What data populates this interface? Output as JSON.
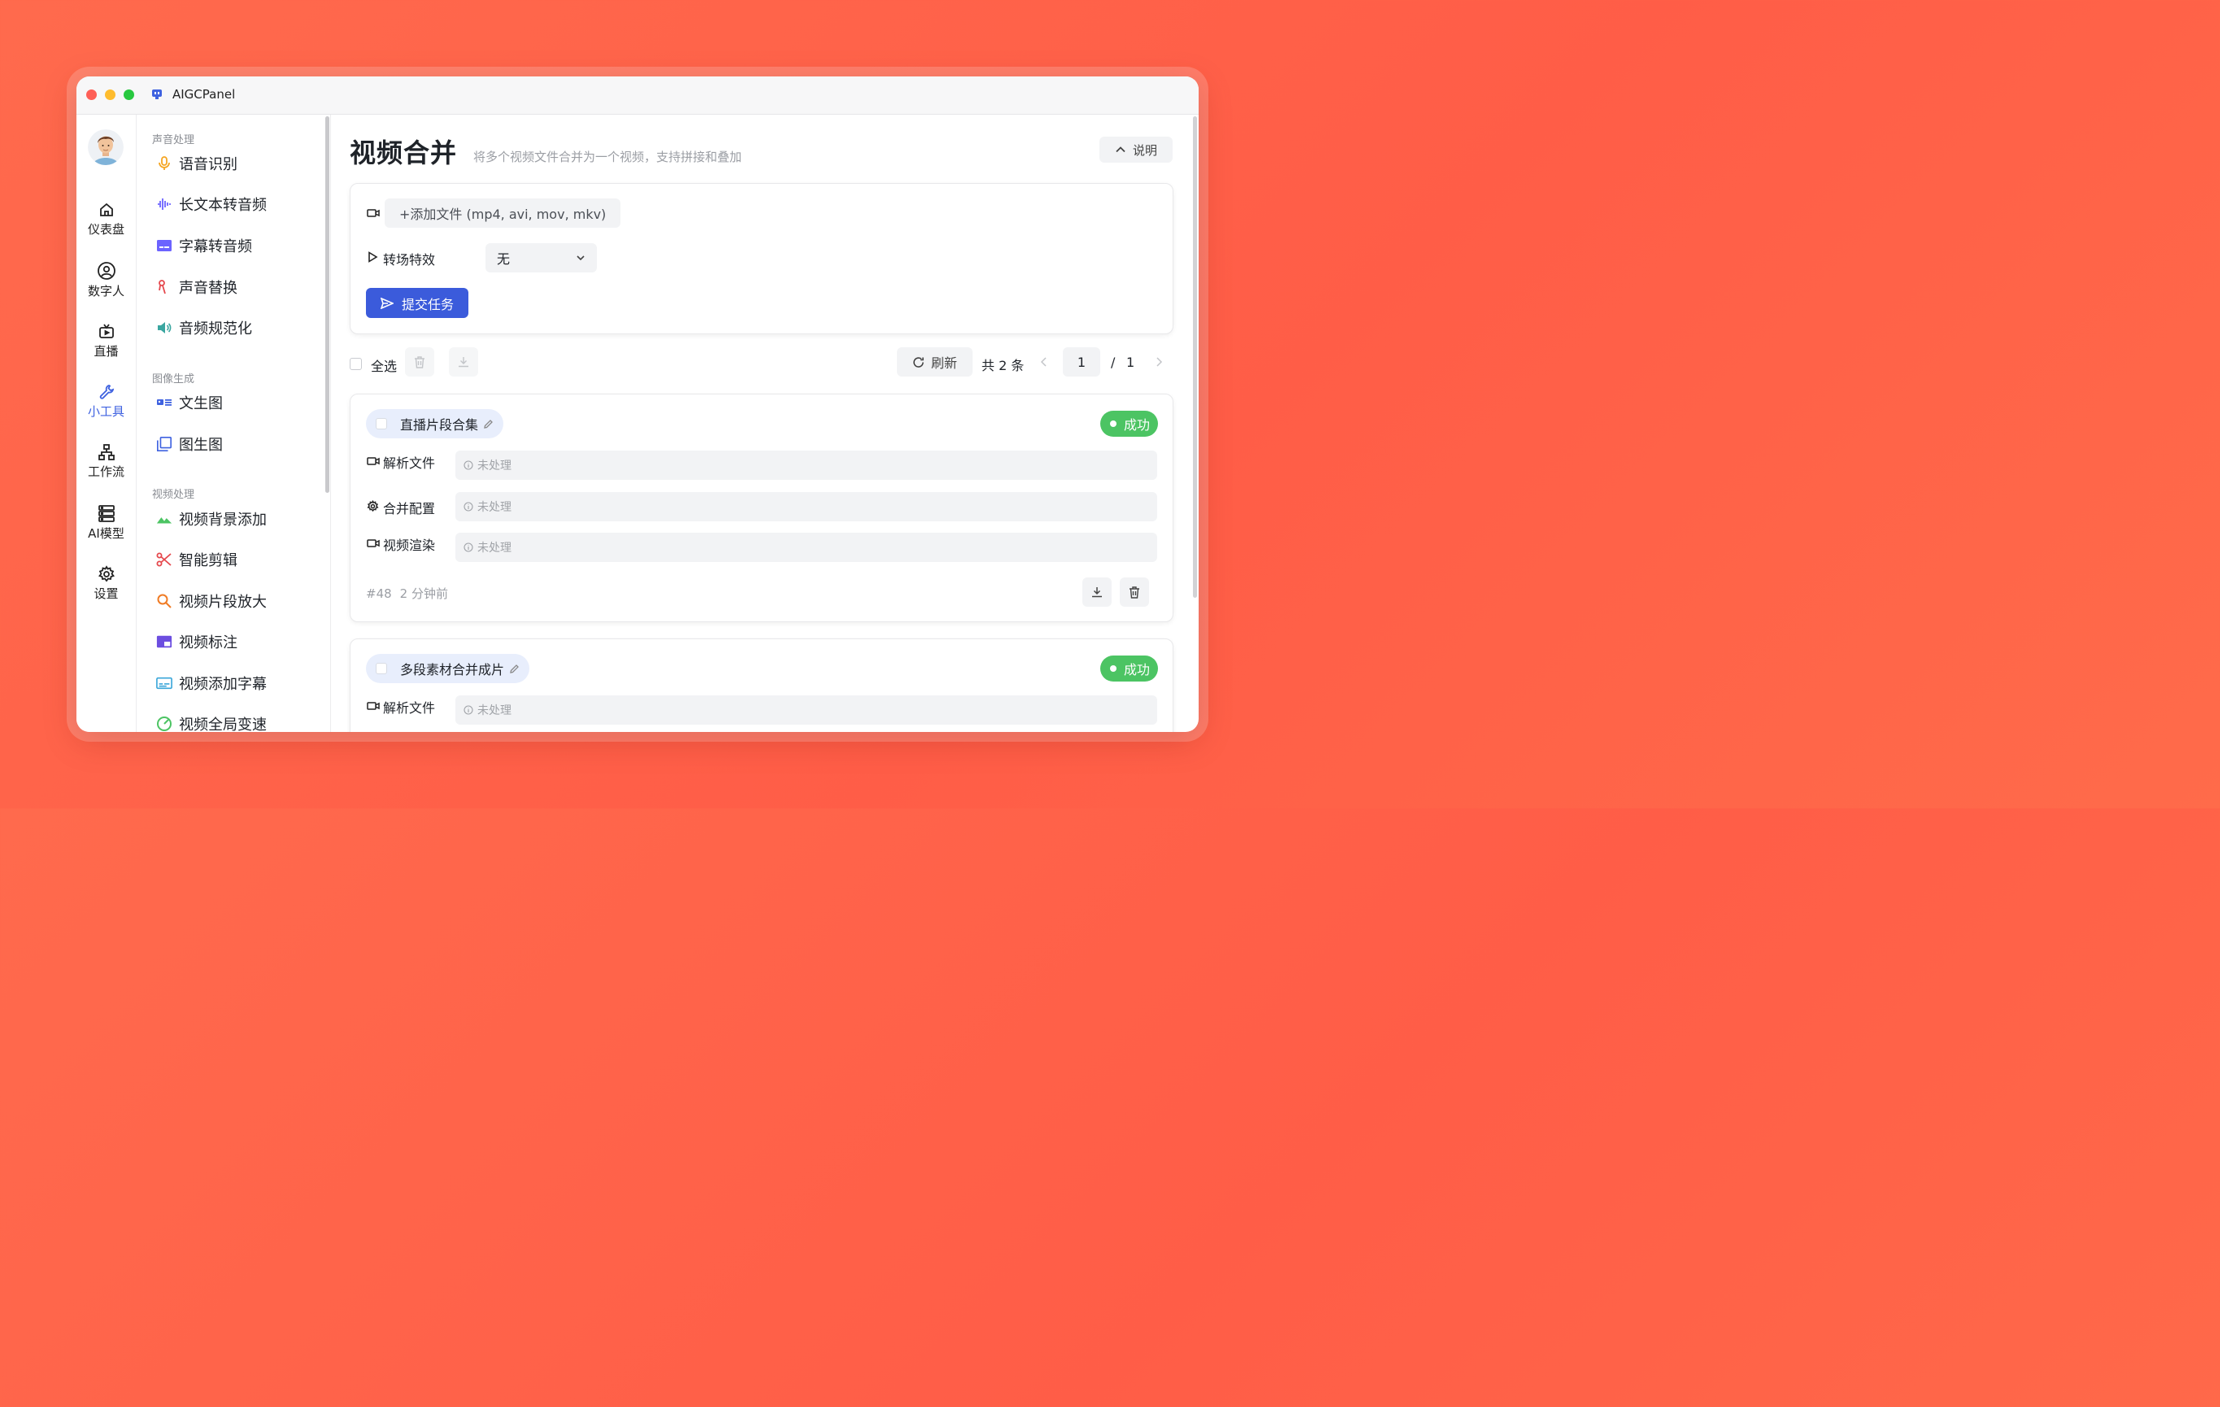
{
  "window": {
    "title": "AIGCPanel"
  },
  "rail": {
    "items": [
      {
        "label": "仪表盘",
        "icon": "home-icon"
      },
      {
        "label": "数字人",
        "icon": "user-circle-icon"
      },
      {
        "label": "直播",
        "icon": "tv-icon"
      },
      {
        "label": "小工具",
        "icon": "wrench-icon",
        "active": true
      },
      {
        "label": "工作流",
        "icon": "workflow-icon"
      },
      {
        "label": "AI模型",
        "icon": "server-icon"
      },
      {
        "label": "设置",
        "icon": "gear-icon"
      }
    ]
  },
  "menu": {
    "groups": [
      {
        "title": "声音处理",
        "items": [
          "语音识别",
          "长文本转音频",
          "字幕转音频",
          "声音替换",
          "音频规范化"
        ]
      },
      {
        "title": "图像生成",
        "items": [
          "文生图",
          "图生图"
        ]
      },
      {
        "title": "视频处理",
        "items": [
          "视频背景添加",
          "智能剪辑",
          "视频片段放大",
          "视频标注",
          "视频添加字幕",
          "视频全局变速"
        ]
      }
    ]
  },
  "page": {
    "title": "视频合并",
    "subtitle": "将多个视频文件合并为一个视频，支持拼接和叠加",
    "help_label": "说明"
  },
  "form": {
    "add_file_label": "+添加文件 (mp4, avi, mov, mkv)",
    "transition_label": "转场特效",
    "transition_value": "无",
    "submit_label": "提交任务"
  },
  "toolbar": {
    "select_all_label": "全选",
    "refresh_label": "刷新",
    "total_label": "共 2 条",
    "page_current": "1",
    "page_sep": "/",
    "page_total": "1"
  },
  "tasks": [
    {
      "name": "直播片段合集",
      "status": "成功",
      "steps": [
        {
          "label": "解析文件",
          "value": "未处理"
        },
        {
          "label": "合并配置",
          "value": "未处理"
        },
        {
          "label": "视频渲染",
          "value": "未处理"
        }
      ],
      "id": "#48",
      "time": "2 分钟前"
    },
    {
      "name": "多段素材合并成片",
      "status": "成功",
      "steps": [
        {
          "label": "解析文件",
          "value": "未处理"
        }
      ]
    }
  ],
  "colors": {
    "accent": "#3b5bdb",
    "success": "#4cc463",
    "background": "#ff5d47"
  }
}
